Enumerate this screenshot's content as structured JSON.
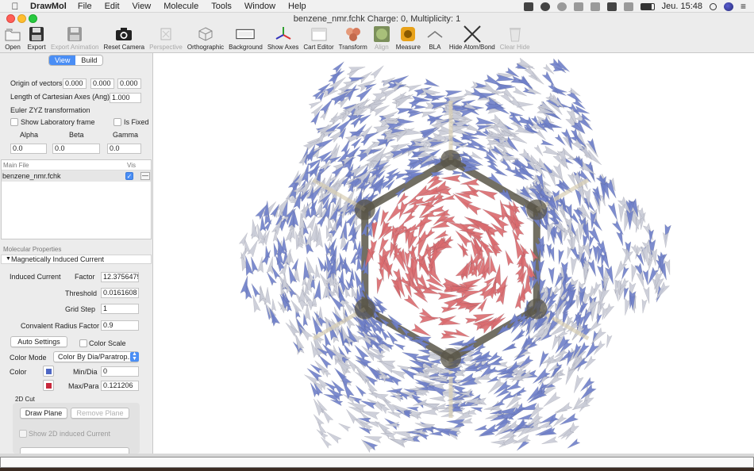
{
  "menubar": {
    "app_name": "DrawMol",
    "menus": [
      "File",
      "Edit",
      "View",
      "Molecule",
      "Tools",
      "Window",
      "Help"
    ],
    "clock": "Jeu. 15:48"
  },
  "window": {
    "title": "benzene_nmr.fchk",
    "charge_label": "Charge:",
    "charge_value": "0,",
    "multiplicity_label": "Multiplicity:",
    "multiplicity_value": "1"
  },
  "toolbar": {
    "open": "Open",
    "export": "Export",
    "export_animation": "Export Animation",
    "reset_camera": "Reset Camera",
    "perspective": "Perspective",
    "orthographic": "Orthographic",
    "background": "Background",
    "show_axes": "Show Axes",
    "cart_editor": "Cart Editor",
    "transform": "Transform",
    "align": "Align",
    "measure": "Measure",
    "bla": "BLA",
    "hide_atom_bond": "Hide Atom/Bond",
    "clear_hide": "Clear Hide"
  },
  "view_panel": {
    "tabs": [
      "View",
      "Build"
    ],
    "origin_label": "Origin of vectors",
    "origin": [
      "0.000",
      "0.000",
      "0.000"
    ],
    "axes_length_label": "Length of Cartesian Axes (Ang)",
    "axes_length": "1.000",
    "euler_label": "Euler ZYZ transformation",
    "show_lab_frame": "Show Laboratory frame",
    "is_fixed": "Is Fixed",
    "alpha_label": "Alpha",
    "beta_label": "Beta",
    "gamma_label": "Gamma",
    "alpha": "0.0",
    "beta": "0.0",
    "gamma": "0.0"
  },
  "files": {
    "header_main": "Main File",
    "header_vis": "Vis",
    "rows": [
      {
        "name": "benzene_nmr.fchk",
        "visible": true
      }
    ]
  },
  "molprops": {
    "header": "Molecular Properties",
    "section": "Magnetically Induced Current",
    "induced_current": "Induced Current",
    "factor_label": "Factor",
    "factor": "12.3756475",
    "threshold_label": "Threshold",
    "threshold": "0.0161608",
    "grid_step_label": "Grid Step",
    "grid_step": "1",
    "covalent_label": "Convalent Radius Factor",
    "covalent": "0.9",
    "auto_settings": "Auto Settings",
    "color_scale": "Color Scale",
    "color_mode_label": "Color Mode",
    "color_mode": "Color By Dia/Paratrop...",
    "color_label": "Color",
    "min_dia_label": "Min/Dia",
    "min_dia": "0",
    "max_para_label": "Max/Para",
    "max_para": "0.121206",
    "dia_color": "#4e67c4",
    "para_color": "#c8283c",
    "cut_label": "2D Cut",
    "draw_plane": "Draw Plane",
    "remove_plane": "Remove Plane",
    "show_2d": "Show 2D induced Current"
  },
  "scene": {
    "dia_arrow_color": "#6f7fc9",
    "neutral_arrow_color": "#c9cbd6",
    "para_arrow_color": "#d96a6e",
    "bond_color": "#5a5648",
    "hydrogen_color": "#d9cfb4"
  }
}
